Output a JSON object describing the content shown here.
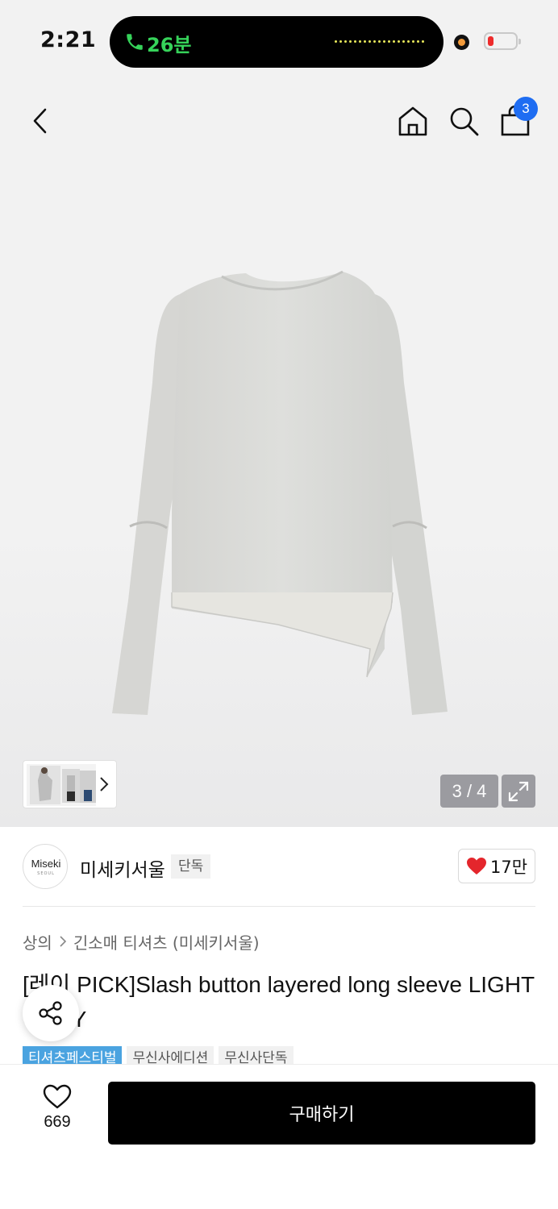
{
  "status_bar": {
    "time": "2:21",
    "call_duration": "26분",
    "icons": [
      "phone-icon",
      "microphone-indicator",
      "battery-icon"
    ]
  },
  "header": {
    "icons": [
      "back-arrow-icon",
      "home-icon",
      "search-icon",
      "shopping-bag-icon"
    ],
    "cart_count": "3"
  },
  "gallery": {
    "counter": "3 / 4",
    "icons": [
      "expand-icon",
      "chevron-right-icon"
    ]
  },
  "brand": {
    "logo_text": "Miseki",
    "logo_subtext": "SEOUL",
    "name": "미세키서울",
    "badge": "단독",
    "like_count": "17만",
    "like_icon": "heart-filled-icon",
    "like_color": "#e4262c"
  },
  "breadcrumb": {
    "level1": "상의",
    "level2": "긴소매 티셔츠 (미세키서울)"
  },
  "product": {
    "title": "[레이 PICK]Slash button layered long sleeve LIGHT GREY"
  },
  "tags": [
    "티셔츠페스티벌",
    "무신사에디션",
    "무신사단독"
  ],
  "colors": {
    "festival_tag": "#4aa3e0",
    "cart_badge": "#1f6df2",
    "call_green": "#36d35a",
    "buy_button": "#000000"
  },
  "bottom_bar": {
    "wish_count": "669",
    "buy_label": "구매하기"
  }
}
